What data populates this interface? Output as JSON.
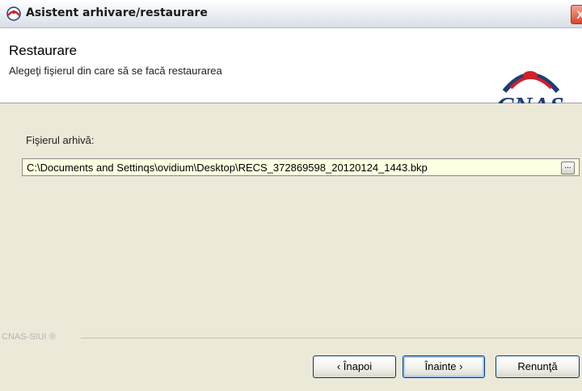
{
  "window": {
    "title": "Asistent arhivare/restaurare",
    "close_symbol": "X",
    "app_icon": "cnas-logo-icon"
  },
  "header": {
    "title": "Restaurare",
    "subtitle": "Alegeţi fişierul din care să se facă restaurarea",
    "logo_text": "CNAS"
  },
  "form": {
    "label": "Fişierul arhivă:",
    "path_value": "C:\\Documents and Settinqs\\ovidium\\Desktop\\RECS_372869598_20120124_1443.bkp",
    "browse_label": "..."
  },
  "footer": {
    "brand": "CNAS-SIUI ®",
    "back_label": "‹ Înapoi",
    "next_label": "Înainte ›",
    "cancel_label": "Renunţă"
  }
}
